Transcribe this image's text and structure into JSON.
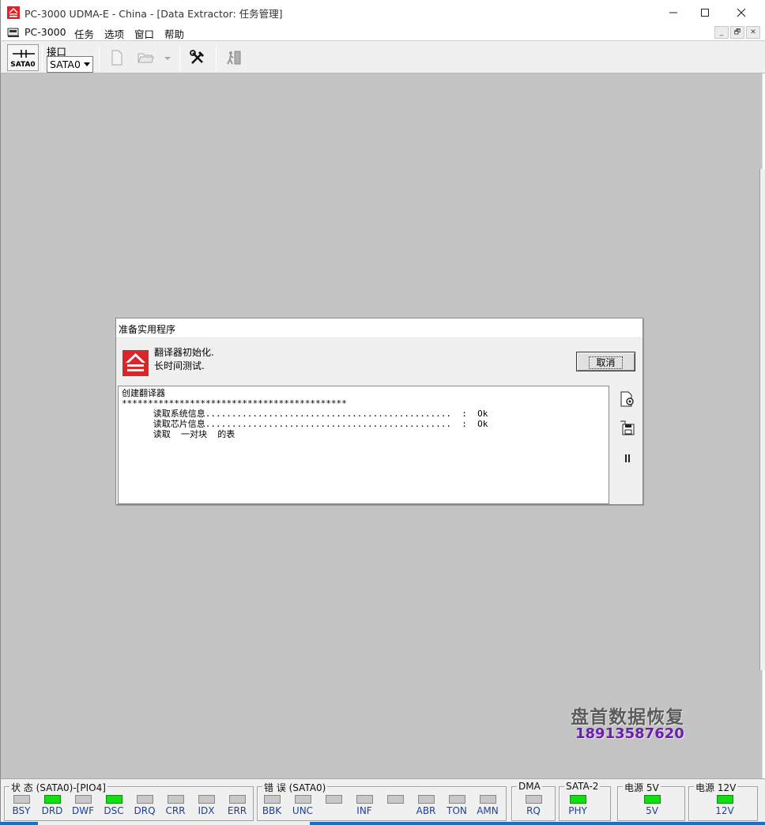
{
  "window": {
    "title": "PC-3000 UDMA-E - China - [Data Extractor: 任务管理]",
    "buttons": {
      "minimize": "—",
      "maximize": "☐",
      "close": "✕"
    }
  },
  "menu": {
    "items": [
      "PC-3000",
      "任务",
      "选项",
      "窗口",
      "帮助"
    ],
    "mdi": [
      "_",
      "🗗",
      "✕"
    ]
  },
  "toolbar": {
    "port_button_label": "SATA0",
    "port_label": "接口",
    "port_value": "SATA0"
  },
  "dialog": {
    "title": "准备实用程序",
    "status_line_1": "翻译器初始化.",
    "status_line_2": "长时间测试.",
    "cancel_label": "取消",
    "log": [
      "创建翻译器",
      "*******************************************",
      "      读取系统信息...............................................  :  Ok",
      "      读取芯片信息...............................................  :  Ok",
      "      读取  一对块  的表"
    ],
    "side_icons": [
      "settings-page-icon",
      "save-disk-icon",
      "pause-icon"
    ]
  },
  "watermark": {
    "name": "盘首数据恢复",
    "phone": "18913587620"
  },
  "status": {
    "groups": [
      {
        "title": "状 态 (SATA0)-[PIO4]",
        "leds": [
          {
            "label": "BSY",
            "on": false
          },
          {
            "label": "DRD",
            "on": true
          },
          {
            "label": "DWF",
            "on": false
          },
          {
            "label": "DSC",
            "on": true
          },
          {
            "label": "DRQ",
            "on": false
          },
          {
            "label": "CRR",
            "on": false
          },
          {
            "label": "IDX",
            "on": false
          },
          {
            "label": "ERR",
            "on": false
          }
        ]
      },
      {
        "title": "错 误 (SATA0)",
        "leds": [
          {
            "label": "BBK",
            "on": false
          },
          {
            "label": "UNC",
            "on": false
          },
          {
            "label": "",
            "on": false
          },
          {
            "label": "INF",
            "on": false
          },
          {
            "label": "",
            "on": false
          },
          {
            "label": "ABR",
            "on": false
          },
          {
            "label": "TON",
            "on": false
          },
          {
            "label": "AMN",
            "on": false
          }
        ]
      },
      {
        "title": "DMA",
        "leds": [
          {
            "label": "RQ",
            "on": false
          }
        ]
      },
      {
        "title": "SATA-2",
        "leds": [
          {
            "label": "PHY",
            "on": true
          }
        ]
      },
      {
        "title": "电源 5V",
        "leds": [
          {
            "label": "5V",
            "on": true
          }
        ]
      },
      {
        "title": "电源 12V",
        "leds": [
          {
            "label": "12V",
            "on": true
          }
        ]
      }
    ]
  },
  "colors": {
    "brand_red": "#d8262a",
    "workspace_gray": "#c4c4c4",
    "led_on": "#10e010",
    "led_off": "#c8c8c8",
    "status_label_blue": "#1a3fa0",
    "watermark_purple": "#6a1fb0"
  }
}
